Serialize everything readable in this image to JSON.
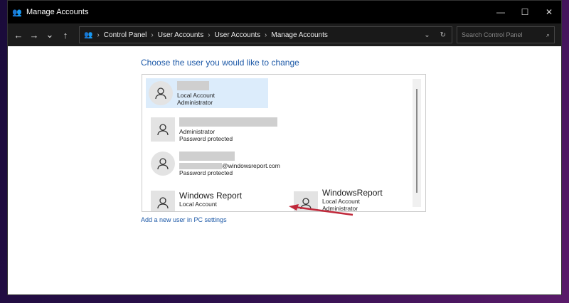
{
  "window": {
    "title": "Manage Accounts",
    "minimize": "—",
    "maximize": "☐",
    "close": "✕"
  },
  "toolbar": {
    "back": "←",
    "forward": "→",
    "recent": "⌄",
    "up": "↑",
    "breadcrumb": [
      "Control Panel",
      "User Accounts",
      "User Accounts",
      "Manage Accounts"
    ],
    "sep": "›",
    "dropdown": "⌄",
    "refresh": "↻",
    "search_placeholder": "Search Control Panel",
    "search_icon": "⌕"
  },
  "main": {
    "heading": "Choose the user you would like to change",
    "accounts": [
      {
        "lines": [
          "Local Account",
          "Administrator"
        ]
      },
      {
        "lines": [
          "Administrator",
          "Password protected"
        ]
      },
      {
        "email_suffix": "@windowsreport.com",
        "lines": [
          "Password protected"
        ]
      },
      {
        "name": "Windows Report",
        "lines": [
          "Local Account"
        ]
      },
      {
        "name": "WindowsReport",
        "lines": [
          "Local Account",
          "Administrator"
        ]
      }
    ],
    "add_link": "Add a new user in PC settings",
    "arrow_color": "#c0283a"
  }
}
